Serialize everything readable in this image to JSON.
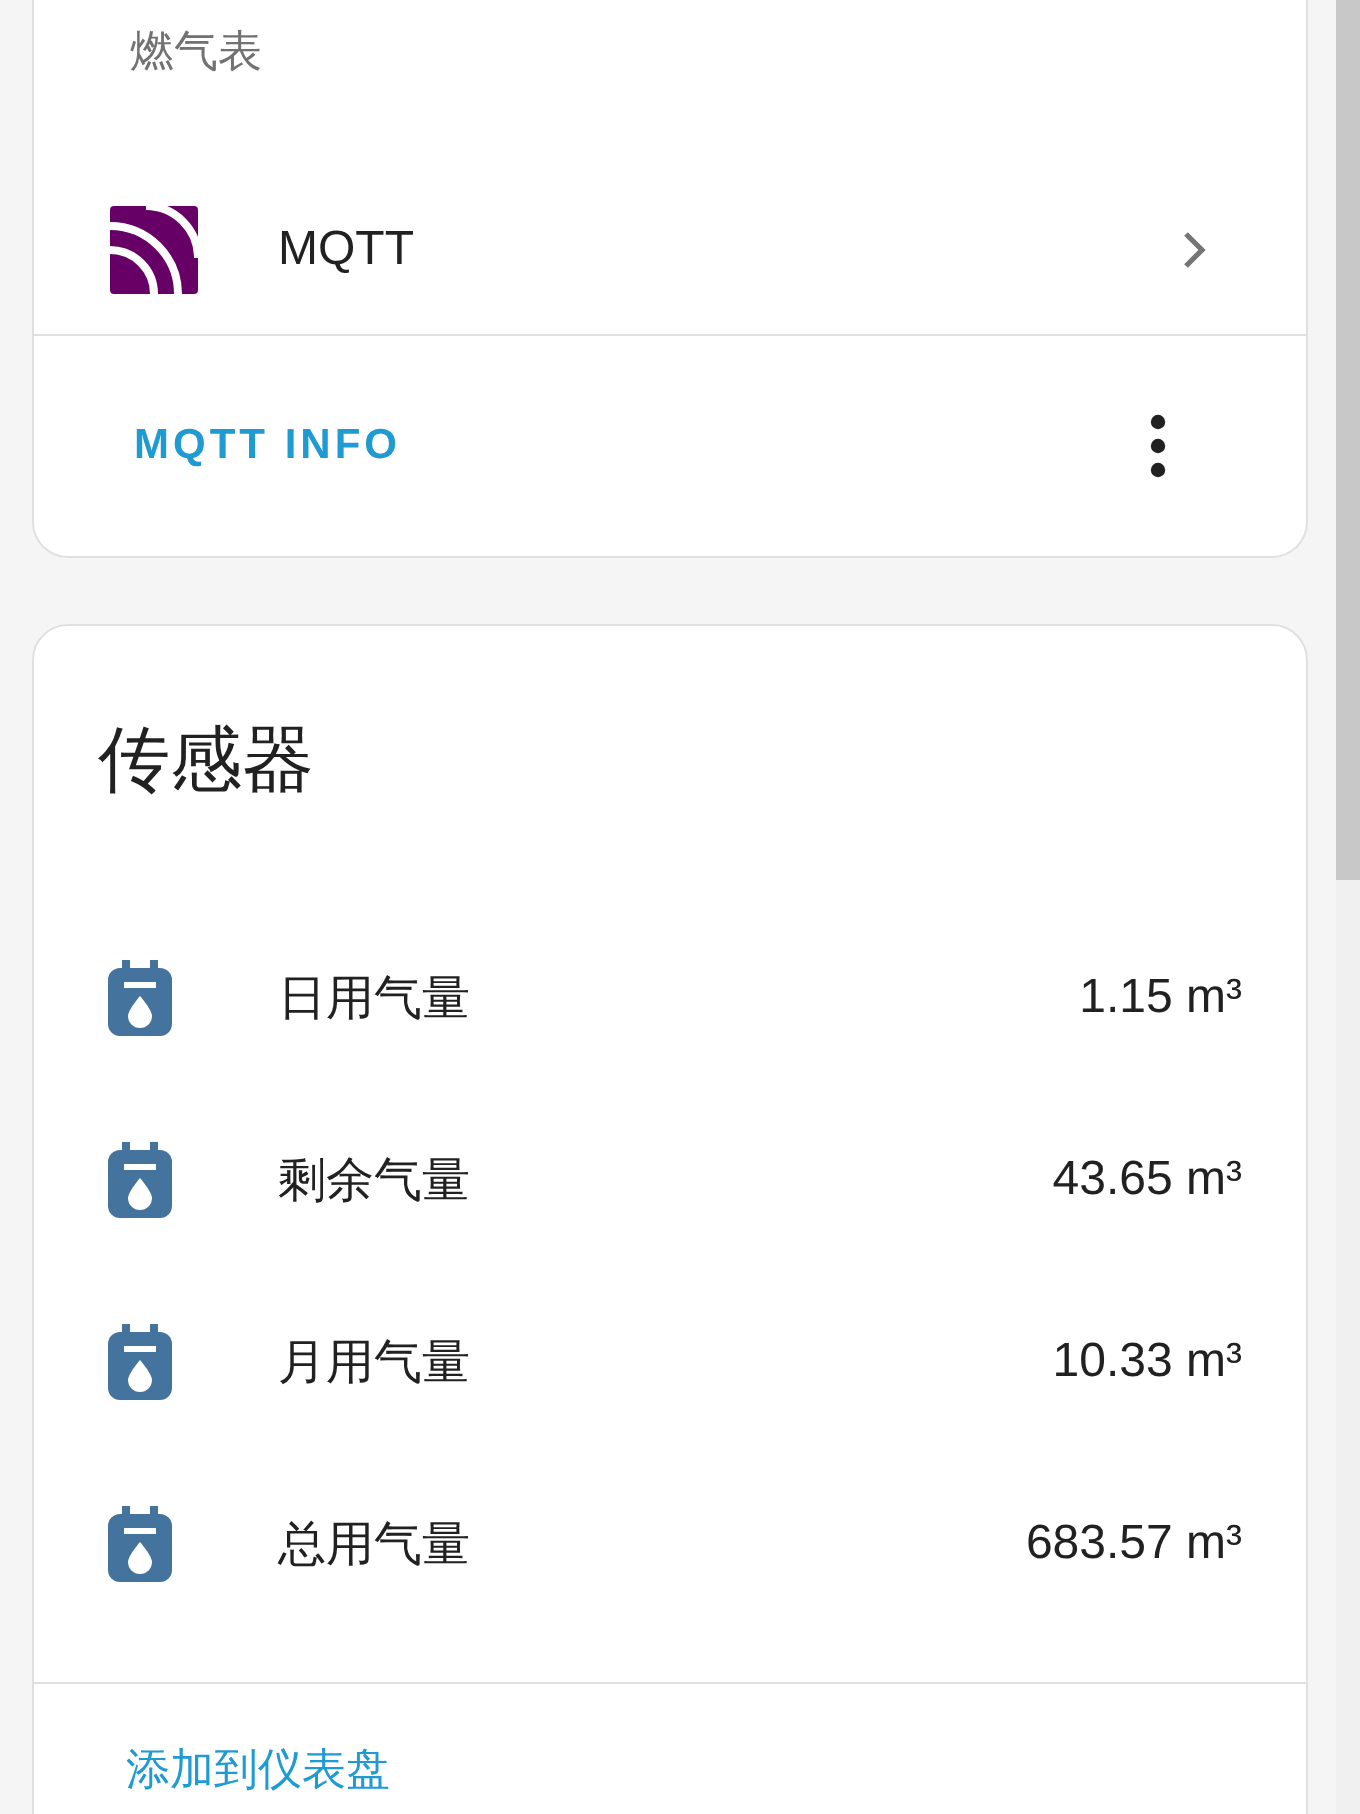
{
  "device_card": {
    "title": "燃气表",
    "integration": {
      "name": "MQTT"
    },
    "action": "MQTT INFO"
  },
  "sensors_card": {
    "title": "传感器",
    "sensors": [
      {
        "name": "日用气量",
        "value": "1.15 m³"
      },
      {
        "name": "剩余气量",
        "value": "43.65 m³"
      },
      {
        "name": "月用气量",
        "value": "10.33 m³"
      },
      {
        "name": "总用气量",
        "value": "683.57 m³"
      }
    ],
    "action": "添加到仪表盘"
  }
}
